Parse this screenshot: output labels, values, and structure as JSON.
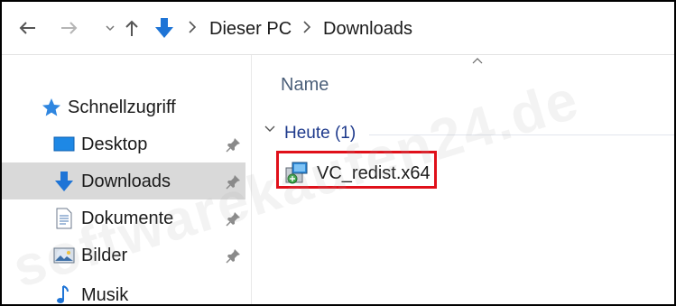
{
  "address_bar": {
    "back_icon": "back-arrow-icon",
    "forward_icon": "forward-arrow-icon",
    "up_icon": "up-arrow-icon",
    "location_icon": "downloads-arrow-icon",
    "breadcrumbs": [
      "Dieser PC",
      "Downloads"
    ]
  },
  "nav_pane": {
    "quick_access": {
      "label": "Schnellzugriff",
      "icon": "star-icon"
    },
    "items": [
      {
        "label": "Desktop",
        "icon": "desktop-icon",
        "pinned": true,
        "selected": false
      },
      {
        "label": "Downloads",
        "icon": "download-icon",
        "pinned": true,
        "selected": true
      },
      {
        "label": "Dokumente",
        "icon": "document-icon",
        "pinned": true,
        "selected": false
      },
      {
        "label": "Bilder",
        "icon": "pictures-icon",
        "pinned": true,
        "selected": false
      },
      {
        "label": "Musik",
        "icon": "music-icon",
        "pinned": false,
        "selected": false
      }
    ]
  },
  "content": {
    "column_header": "Name",
    "sort_indicator": "^",
    "group": {
      "label": "Heute (1)"
    },
    "files": [
      {
        "name": "VC_redist.x64",
        "icon": "installer-icon",
        "highlighted": true
      }
    ]
  },
  "watermark": "softwarekaufen24.de",
  "colors": {
    "selection": "#d9d9d9",
    "accent_blue": "#1e74d6",
    "group_header": "#1e3a8c",
    "highlight_box": "#e0101a"
  }
}
